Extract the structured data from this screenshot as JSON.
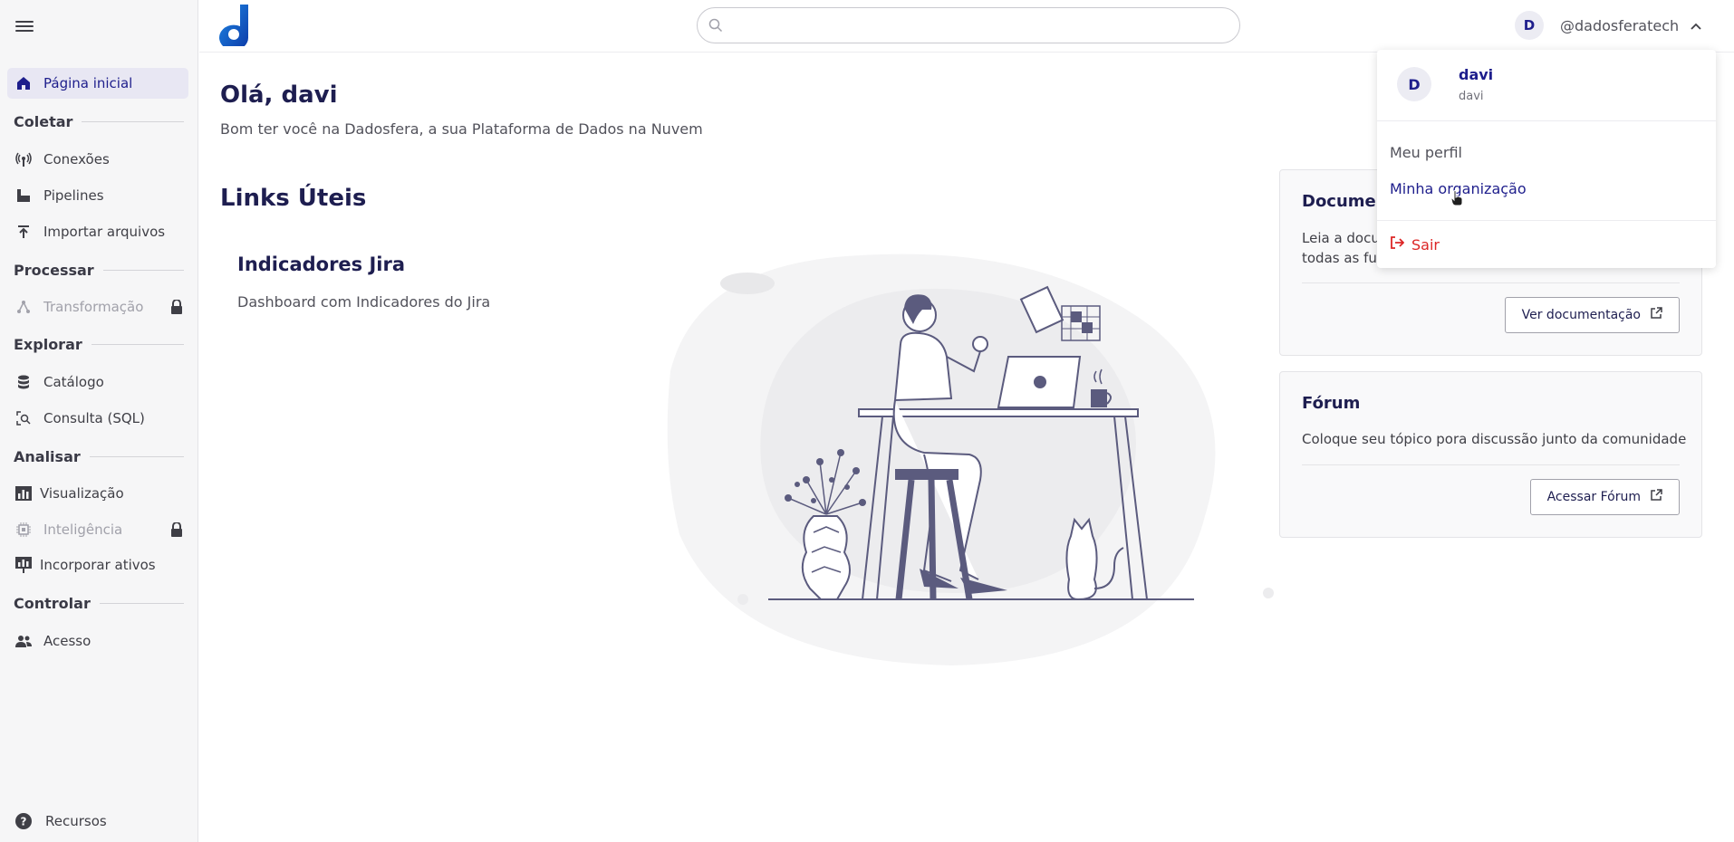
{
  "sidebar": {
    "home_label": "Página inicial",
    "sections": {
      "coletar": "Coletar",
      "processar": "Processar",
      "explorar": "Explorar",
      "analisar": "Analisar",
      "controlar": "Controlar"
    },
    "items": {
      "conexoes": "Conexões",
      "pipelines": "Pipelines",
      "importar": "Importar arquivos",
      "transformacao": "Transformação",
      "catalogo": "Catálogo",
      "consulta": "Consulta (SQL)",
      "visualizacao": "Visualização",
      "inteligencia": "Inteligência",
      "incorporar": "Incorporar ativos",
      "acesso": "Acesso"
    },
    "resources_label": "Recursos"
  },
  "header": {
    "search_placeholder": "",
    "user_initial": "D",
    "user_handle": "@dadosferatech"
  },
  "main": {
    "greeting": "Olá, davi",
    "subtitle": "Bom ter você na Dadosfera, a sua Plataforma de Dados na Nuvem",
    "links_title": "Links Úteis",
    "link_card": {
      "title": "Indicadores Jira",
      "description": "Dashboard com Indicadores do Jira"
    }
  },
  "cards": {
    "docs": {
      "title": "Document",
      "text_line1": "Leia a docu",
      "text_line2": "todas as fur",
      "button": "Ver documentação"
    },
    "forum": {
      "title": "Fórum",
      "text": "Coloque seu tópico pora discussão junto da comunidade",
      "button": "Acessar Fórum"
    }
  },
  "user_menu": {
    "initial": "D",
    "name": "davi",
    "username": "davi",
    "profile": "Meu perfil",
    "organization": "Minha organização",
    "logout": "Sair"
  },
  "colors": {
    "accent": "#1e1e8c",
    "logo_blue": "#1565d8",
    "logout_red": "#dc2626"
  }
}
